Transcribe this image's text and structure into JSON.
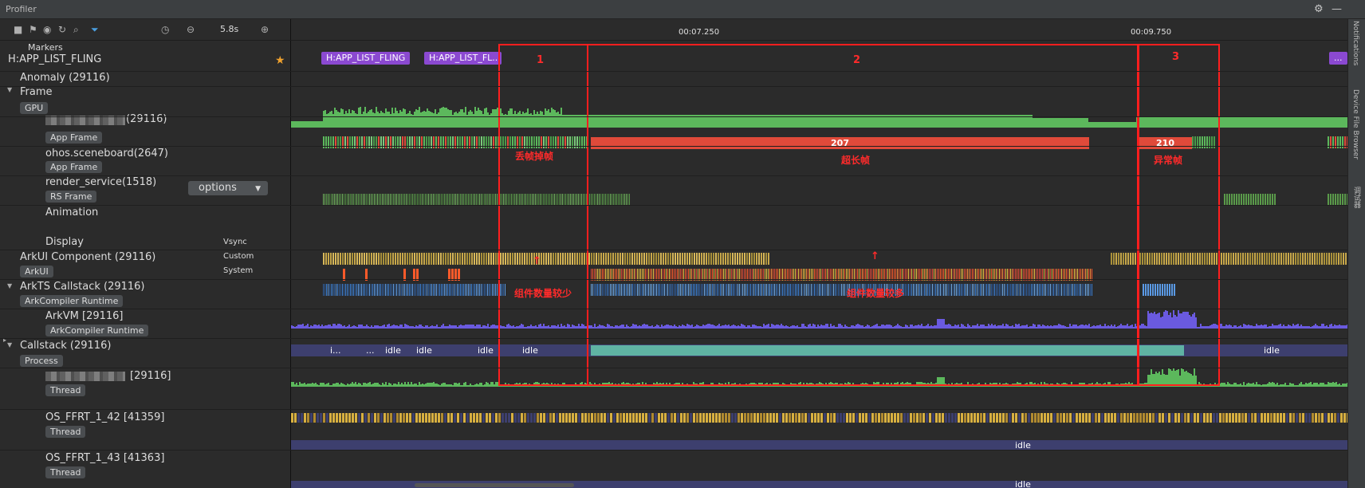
{
  "titlebar": {
    "title": "Profiler"
  },
  "toolbar": {
    "zoom_level": "5.8s"
  },
  "ruler": {
    "ticks": [
      "00:07.250",
      "00:09.750"
    ]
  },
  "markers": {
    "header": "Markers",
    "track_name": "H:APP_LIST_FLING",
    "chips": [
      "H:APP_LIST_FLING",
      "H:APP_LIST_FL...",
      "..."
    ]
  },
  "tracks": {
    "anomaly": "Anomaly (29116)",
    "frame": {
      "label": "Frame",
      "chip": "GPU"
    },
    "app": {
      "label": "(29116)",
      "chip": "App Frame",
      "frame_207": "207",
      "frame_210": "210"
    },
    "sceneboard": {
      "label": "ohos.sceneboard(2647)",
      "chip": "App Frame"
    },
    "render": {
      "label": "render_service(1518)",
      "chip": "RS Frame",
      "options": "options"
    },
    "animation": {
      "label": "Animation"
    },
    "display": {
      "label": "Display",
      "sub": "Vsync"
    },
    "arkui": {
      "label": "ArkUI Component (29116)",
      "chip": "ArkUI",
      "sub1": "Custom",
      "sub2": "System"
    },
    "arkts": {
      "label": "ArkTS Callstack (29116)",
      "chip": "ArkCompiler Runtime"
    },
    "arkvm": {
      "label": "ArkVM [29116]",
      "chip": "ArkCompiler Runtime",
      "slices": [
        "i...",
        "...",
        "idle",
        "idle",
        "idle",
        "idle",
        "idle"
      ]
    },
    "callstack": {
      "label": "Callstack (29116)",
      "chip": "Process"
    },
    "thread_main": {
      "label": "[29116]",
      "chip": "Thread"
    },
    "ffrt42": {
      "label": "OS_FFRT_1_42 [41359]",
      "chip": "Thread",
      "idle": "idle"
    },
    "ffrt43": {
      "label": "OS_FFRT_1_43 [41363]",
      "chip": "Thread",
      "idle": "idle"
    }
  },
  "annotations": {
    "region_numbers": [
      "1",
      "2",
      "3"
    ],
    "notes": [
      "丢帧掉帧",
      "超长帧",
      "异常帧",
      "组件数量较少",
      "组件数量较多"
    ]
  },
  "side_panel": {
    "labels": [
      "Notifications",
      "Device File Browser",
      "调试器"
    ]
  },
  "colors": {
    "frame_green": "#5cb85c",
    "jank_red": "#e04a3a",
    "marker_purple": "#8b49d1",
    "annotation_red": "#ff1e1e",
    "vsync_yellow": "#c8a84a",
    "arkui_blue": "#3a7fd5"
  }
}
